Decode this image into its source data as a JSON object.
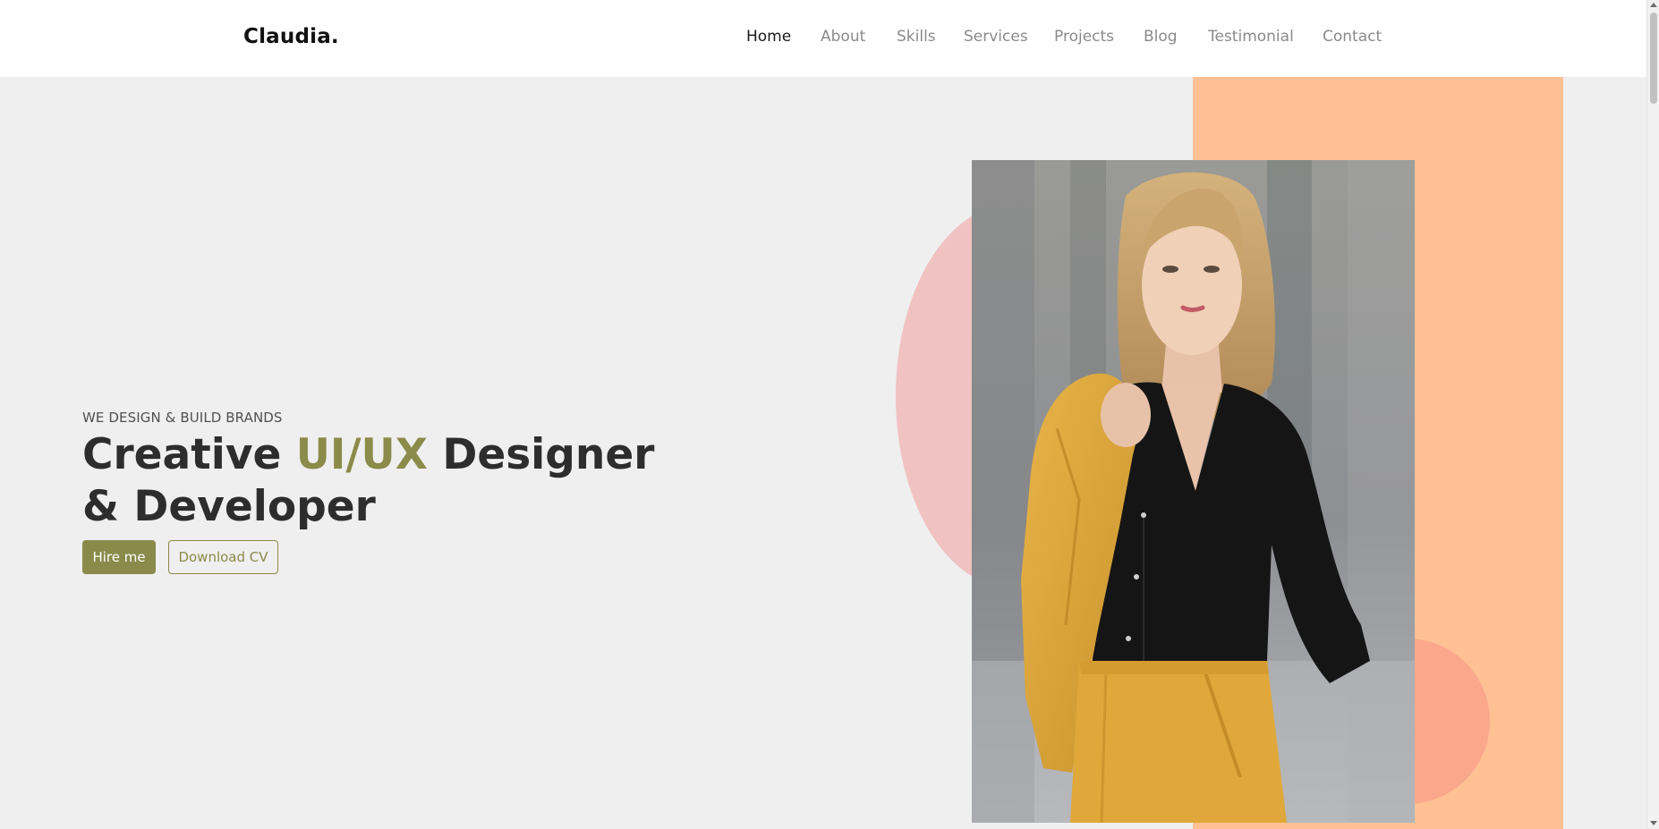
{
  "nav": {
    "brand": "Claudia.",
    "items": [
      {
        "label": "Home",
        "active": true
      },
      {
        "label": "About"
      },
      {
        "label": "Skills"
      },
      {
        "label": "Services"
      },
      {
        "label": "Projects"
      },
      {
        "label": "Blog"
      },
      {
        "label": "Testimonial"
      },
      {
        "label": "Contact"
      }
    ]
  },
  "hero": {
    "subtitle": "WE DESIGN & BUILD BRANDS",
    "headline_part1": "Creative ",
    "headline_accent": "UI/UX",
    "headline_part2": " Designer & Developer",
    "hire_label": "Hire me",
    "download_label": "Download CV"
  },
  "colors": {
    "accent": "#8a8a4b",
    "background": "#efefef",
    "peach": "#ffc194",
    "pink": "#f0c2c1",
    "salmon": "#fba78b",
    "jacket": "#e0a83a",
    "blouse": "#151515"
  },
  "photo": {
    "icon": "portrait-photo"
  }
}
